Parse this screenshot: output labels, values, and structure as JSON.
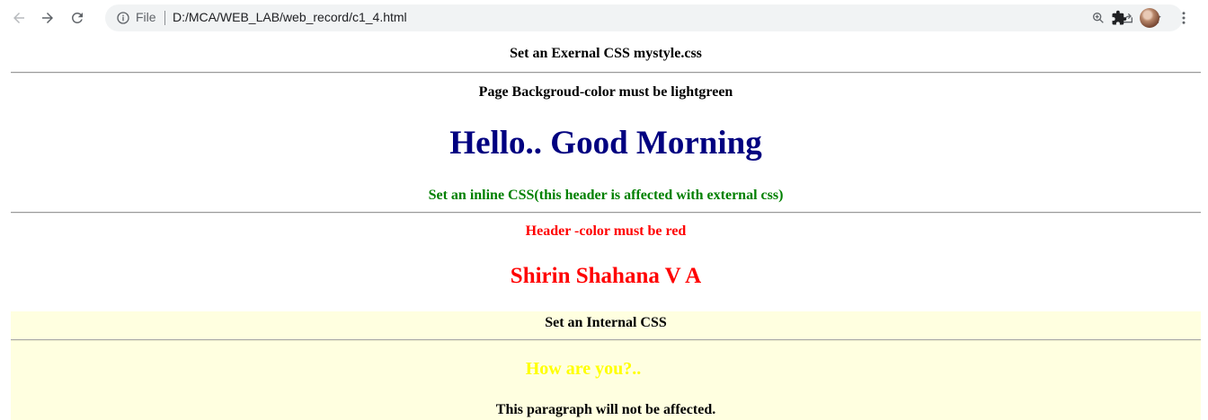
{
  "browser": {
    "scheme_label": "File",
    "url": "D:/MCA/WEB_LAB/web_record/c1_4.html",
    "icons": [
      "back-arrow-icon",
      "forward-arrow-icon",
      "reload-icon",
      "info-icon",
      "zoom-icon",
      "share-icon",
      "star-icon",
      "extensions-icon",
      "profile-avatar",
      "more-menu-icon"
    ]
  },
  "page": {
    "external_heading": "Set an Exernal CSS mystyle.css",
    "bg_note": "Page Backgroud-color must be lightgreen",
    "greeting": "Hello.. Good Morning",
    "inline_heading": "Set an inline CSS(this header is affected with external css)",
    "header_note": "Header -color must be red",
    "name": "Shirin Shahana V A",
    "internal_heading": "Set an Internal CSS",
    "question": "How are you?..",
    "paragraph": "This paragraph will not be affected."
  },
  "colors": {
    "greeting": "#000080",
    "inline_heading": "#008000",
    "red": "#ff0000",
    "question": "#ffff00",
    "internal_bg": "#ffffe0"
  }
}
